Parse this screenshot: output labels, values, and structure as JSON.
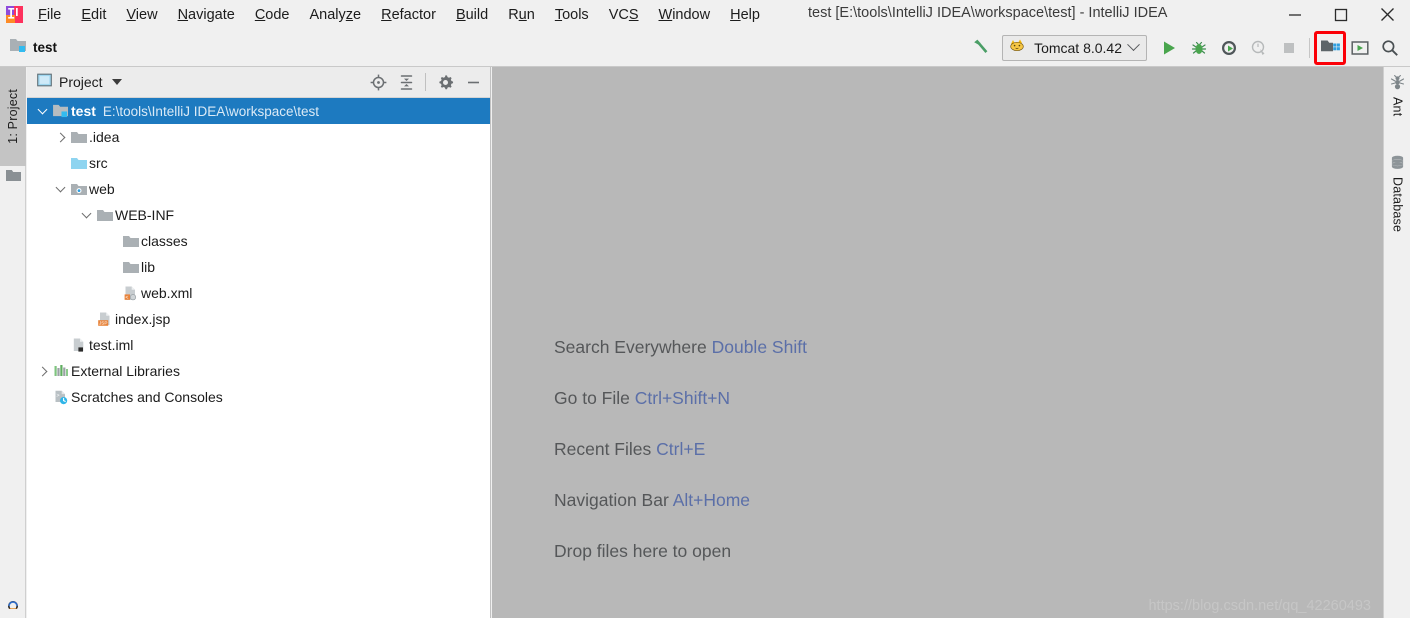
{
  "window": {
    "title": "test [E:\\tools\\IntelliJ IDEA\\workspace\\test] - IntelliJ IDEA",
    "logo_icon": "intellij-idea-logo",
    "minimize_label": "Minimize",
    "maximize_label": "Maximize",
    "close_label": "Close"
  },
  "menubar": {
    "items": [
      {
        "label": "File",
        "mnemonic": "F"
      },
      {
        "label": "Edit",
        "mnemonic": "E"
      },
      {
        "label": "View",
        "mnemonic": "V"
      },
      {
        "label": "Navigate",
        "mnemonic": "N"
      },
      {
        "label": "Code",
        "mnemonic": "C"
      },
      {
        "label": "Analyze",
        "mnemonic": "z"
      },
      {
        "label": "Refactor",
        "mnemonic": "R"
      },
      {
        "label": "Build",
        "mnemonic": "B"
      },
      {
        "label": "Run",
        "mnemonic": "u"
      },
      {
        "label": "Tools",
        "mnemonic": "T"
      },
      {
        "label": "VCS",
        "mnemonic": "S"
      },
      {
        "label": "Window",
        "mnemonic": "W"
      },
      {
        "label": "Help",
        "mnemonic": "H"
      }
    ]
  },
  "toolbar": {
    "project_name": "test",
    "project_icon": "project-folder-icon",
    "build_icon": "build-hammer-icon",
    "run_config": {
      "label": "Tomcat 8.0.42",
      "icon": "tomcat-cat-icon",
      "dropdown_icon": "chevron-down-icon"
    },
    "run_icon": "run-play-icon",
    "debug_icon": "debug-bug-icon",
    "run_coverage_icon": "run-with-coverage-icon",
    "profile_icon": "profile-icon",
    "stop_icon": "stop-square-icon",
    "project_structure_icon": "project-structure-icon",
    "project_structure_highlighted": true,
    "highlight_color": "#fb0007",
    "update_app_icon": "update-application-icon",
    "search_icon": "search-icon"
  },
  "left_strip": {
    "project_tab": "1: Project",
    "project_tab_icon": "project-tab-icon",
    "folder_icon": "folder-icon",
    "bottom_icon": "structure-tab-icon"
  },
  "project_panel": {
    "title": "Project",
    "title_icon": "project-view-icon",
    "dropdown_icon": "chevron-down-icon",
    "tools": [
      {
        "name": "locate-icon",
        "label": "Select Opened File"
      },
      {
        "name": "collapse-all-icon",
        "label": "Collapse All"
      },
      {
        "name": "gear-icon",
        "label": "Settings"
      },
      {
        "name": "minimize-icon",
        "label": "Hide"
      }
    ],
    "tree": [
      {
        "label": "test",
        "sub": "E:\\tools\\IntelliJ IDEA\\workspace\\test",
        "icon": "project-folder-icon",
        "indent": 0,
        "arrow": "expanded",
        "selected": true
      },
      {
        "label": ".idea",
        "sub": "",
        "icon": "folder-gray-icon",
        "indent": 1,
        "arrow": "collapsed",
        "selected": false
      },
      {
        "label": "src",
        "sub": "",
        "icon": "folder-source-icon",
        "indent": 1,
        "arrow": "none",
        "selected": false
      },
      {
        "label": "web",
        "sub": "",
        "icon": "folder-web-icon",
        "indent": 1,
        "arrow": "expanded",
        "selected": false
      },
      {
        "label": "WEB-INF",
        "sub": "",
        "icon": "folder-gray-icon",
        "indent": 2,
        "arrow": "expanded",
        "selected": false
      },
      {
        "label": "classes",
        "sub": "",
        "icon": "folder-gray-icon",
        "indent": 3,
        "arrow": "none",
        "selected": false
      },
      {
        "label": "lib",
        "sub": "",
        "icon": "folder-gray-icon",
        "indent": 3,
        "arrow": "none",
        "selected": false
      },
      {
        "label": "web.xml",
        "sub": "",
        "icon": "xml-file-icon",
        "indent": 3,
        "arrow": "none",
        "selected": false
      },
      {
        "label": "index.jsp",
        "sub": "",
        "icon": "jsp-file-icon",
        "indent": 2,
        "arrow": "none",
        "selected": false
      },
      {
        "label": "test.iml",
        "sub": "",
        "icon": "iml-file-icon",
        "indent": 1,
        "arrow": "none",
        "selected": false
      },
      {
        "label": "External Libraries",
        "sub": "",
        "icon": "libraries-icon",
        "indent": 0,
        "arrow": "collapsed",
        "selected": false
      },
      {
        "label": "Scratches and Consoles",
        "sub": "",
        "icon": "scratches-icon",
        "indent": 0,
        "arrow": "none",
        "selected": false
      }
    ]
  },
  "editor": {
    "background_color": "#b8b8b8",
    "hints": [
      {
        "action": "Search Everywhere",
        "key": "Double Shift"
      },
      {
        "action": "Go to File",
        "key": "Ctrl+Shift+N"
      },
      {
        "action": "Recent Files",
        "key": "Ctrl+E"
      },
      {
        "action": "Navigation Bar",
        "key": "Alt+Home"
      },
      {
        "action": "Drop files here to open",
        "key": ""
      }
    ],
    "key_color": "#5b6fa8",
    "watermark": "https://blog.csdn.net/qq_42260493"
  },
  "right_strip": {
    "items": [
      {
        "label": "Ant",
        "icon": "ant-icon"
      },
      {
        "label": "Database",
        "icon": "database-icon"
      }
    ]
  }
}
